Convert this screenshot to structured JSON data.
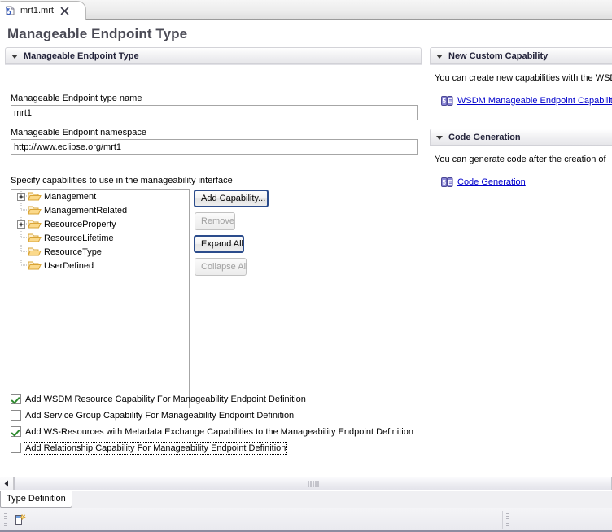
{
  "editor_tab": {
    "label": "mrt1.mrt",
    "icon": "mrt-editor-icon",
    "close_icon": "close-icon"
  },
  "page": {
    "title": "Manageable Endpoint Type"
  },
  "main_section": {
    "title": "Manageable Endpoint Type",
    "twisty_icon": "chevron-down-icon",
    "name_field": {
      "label": "Manageable Endpoint type name",
      "value": "mrt1",
      "placeholder": ""
    },
    "namespace_field": {
      "label": "Manageable Endpoint namespace",
      "value": "http://www.eclipse.org/mrt1",
      "placeholder": ""
    },
    "capabilities_label": "Specify capabilities to use in the manageability interface",
    "tree": {
      "items": [
        {
          "label": "Management",
          "expandable": true,
          "icon": "folder-icon"
        },
        {
          "label": "ManagementRelated",
          "expandable": false,
          "icon": "folder-icon"
        },
        {
          "label": "ResourceProperty",
          "expandable": true,
          "icon": "folder-icon"
        },
        {
          "label": "ResourceLifetime",
          "expandable": false,
          "icon": "folder-icon"
        },
        {
          "label": "ResourceType",
          "expandable": false,
          "icon": "folder-icon"
        },
        {
          "label": "UserDefined",
          "expandable": false,
          "icon": "folder-icon"
        }
      ]
    },
    "buttons": [
      {
        "label": "Add Capability...",
        "enabled": true,
        "default": true
      },
      {
        "label": "Remove",
        "enabled": false,
        "default": false
      },
      {
        "label": "Expand All",
        "enabled": true,
        "default": true
      },
      {
        "label": "Collapse All",
        "enabled": false,
        "default": false
      }
    ],
    "checkboxes": [
      {
        "label": "Add WSDM Resource Capability For Manageability Endpoint Definition",
        "checked": true,
        "focused": false
      },
      {
        "label": "Add Service Group Capability For Manageability Endpoint Definition",
        "checked": false,
        "focused": false
      },
      {
        "label": "Add WS-Resources with Metadata Exchange Capabilities to the Manageability Endpoint Definition",
        "checked": true,
        "focused": false
      },
      {
        "label": "Add Relationship Capability For Manageability Endpoint Definition",
        "checked": false,
        "focused": true
      }
    ]
  },
  "right_panels": [
    {
      "title": "New Custom Capability",
      "twisty_icon": "chevron-down-icon",
      "body": "You can create new capabilities with the WSD",
      "link": {
        "label": "WSDM Manageable Endpoint Capability",
        "icon": "wizard-link-icon"
      }
    },
    {
      "title": "Code Generation",
      "twisty_icon": "chevron-down-icon",
      "body": "You can generate code after the creation of",
      "link": {
        "label": "Code Generation",
        "icon": "wizard-link-icon"
      }
    }
  ],
  "scrollbar": {
    "left_button_icon": "arrow-left-icon",
    "thumb_grip_icon": "grip-icon"
  },
  "page_tabs": [
    {
      "label": "Type Definition",
      "active": true
    }
  ],
  "bottom_toolbar": {
    "left_grip_icon": "toolbar-grip-icon",
    "right_grip_icon": "toolbar-grip-icon",
    "new_icon": "new-document-icon"
  },
  "colors": {
    "link": "#0000cc",
    "title": "#4a4a55",
    "default_button_border": "#2b4c8c",
    "checkbox_check": "#2f8a2f",
    "folder": "#f0b94a"
  }
}
